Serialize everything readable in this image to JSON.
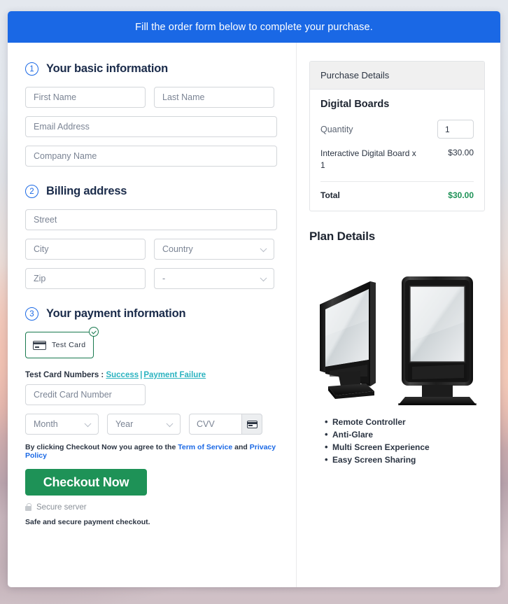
{
  "banner": {
    "text": "Fill the order form below to complete your purchase."
  },
  "sections": [
    {
      "num": "1",
      "title": "Your basic information"
    },
    {
      "num": "2",
      "title": "Billing address"
    },
    {
      "num": "3",
      "title": "Your payment information"
    }
  ],
  "basic_info": {
    "first_name_placeholder": "First Name",
    "last_name_placeholder": "Last Name",
    "email_placeholder": "Email Address",
    "company_placeholder": "Company Name"
  },
  "billing": {
    "street_placeholder": "Street",
    "city_placeholder": "City",
    "country_value": "Country",
    "zip_placeholder": "Zip",
    "state_value": "-"
  },
  "payment": {
    "method_label": "Test  Card",
    "method_icon": "credit-card-icon",
    "selected_icon": "check-circle-icon",
    "test_cards_label": "Test Card Numbers : ",
    "success_link": "Success",
    "separator": "|",
    "failure_link": "Payment Failure",
    "card_number_placeholder": "Credit Card Number",
    "month_value": "Month",
    "year_value": "Year",
    "cvv_placeholder": "CVV",
    "cvv_icon": "credit-card-icon"
  },
  "footer": {
    "terms_prefix": "By clicking Checkout Now you agree to the ",
    "terms_link": "Term of Service",
    "terms_middle": " and ",
    "privacy_link": "Privacy Policy",
    "checkout_label": "Checkout Now",
    "secure_icon": "lock-icon",
    "secure_label": "Secure server",
    "safe_note": "Safe and secure payment checkout."
  },
  "purchase_details": {
    "header": "Purchase Details",
    "product": "Digital Boards",
    "quantity_label": "Quantity",
    "quantity_value": "1",
    "item_name": "Interactive Digital Board x 1",
    "item_price": "$30.00",
    "total_label": "Total",
    "total_value": "$30.00"
  },
  "plan": {
    "title": "Plan Details",
    "image_name": "digital-signage-kiosks-image",
    "features": [
      "Remote Controller",
      "Anti-Glare",
      "Multi Screen Experience",
      "Easy Screen Sharing"
    ]
  },
  "colors": {
    "banner_blue": "#1a68e5",
    "accent_green": "#1e9257",
    "link_blue": "#1a68e5",
    "test_link_teal": "#2bb3c0",
    "heading_navy": "#1a2b4a"
  }
}
